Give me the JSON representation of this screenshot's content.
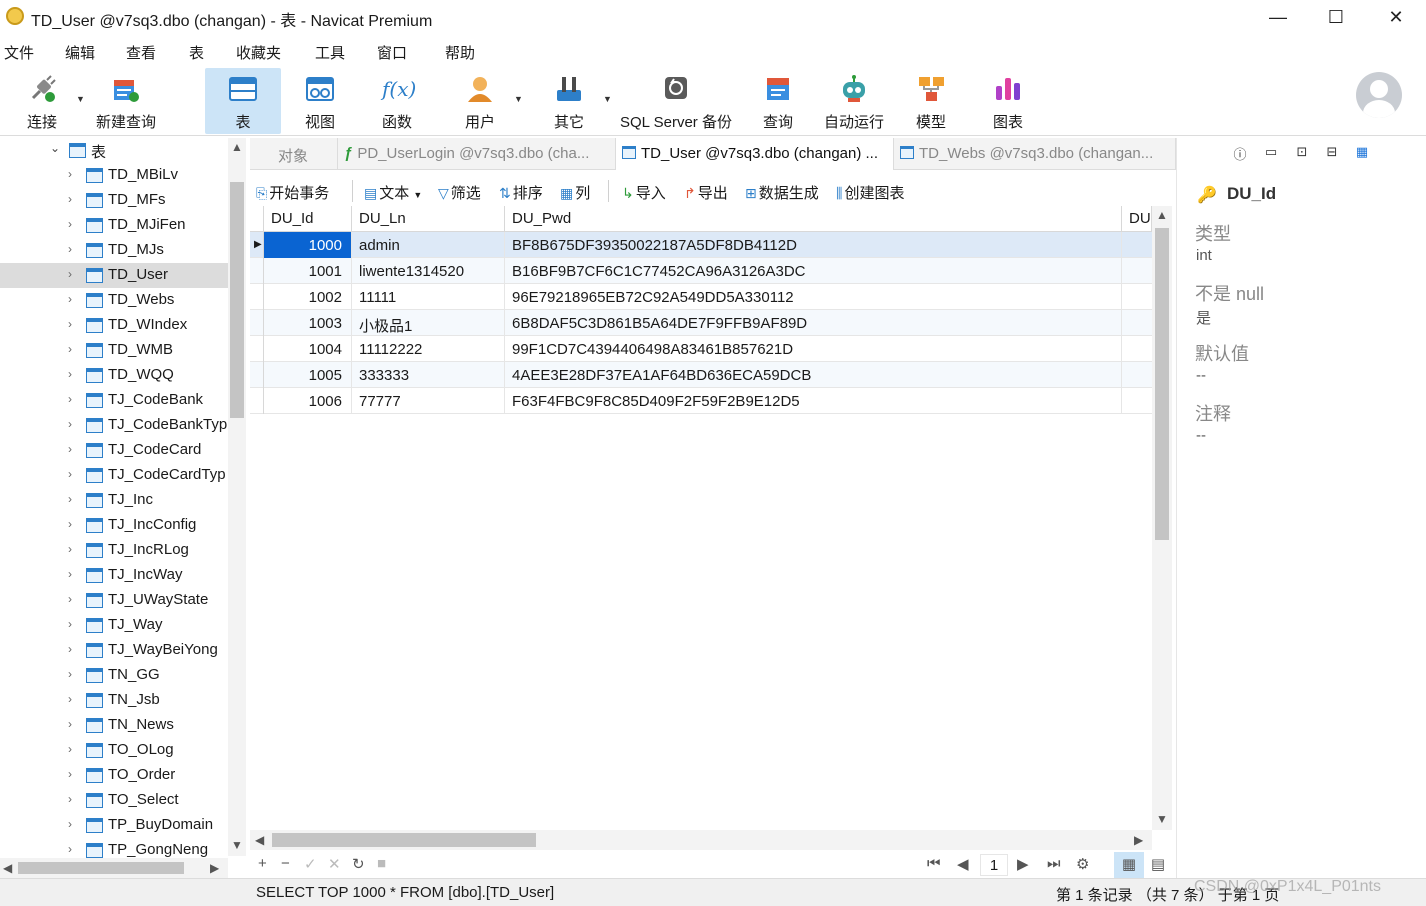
{
  "window": {
    "title": "TD_User @v7sq3.dbo (changan) - 表 - Navicat Premium",
    "minimize": "—",
    "maximize": "☐",
    "close": "✕"
  },
  "menu": [
    "文件",
    "编辑",
    "查看",
    "表",
    "收藏夹",
    "工具",
    "窗口",
    "帮助"
  ],
  "toolbar": [
    {
      "label": "连接",
      "icon": "plug-icon"
    },
    {
      "label": "新建查询",
      "icon": "new-query-icon"
    },
    {
      "label": "表",
      "icon": "table-icon"
    },
    {
      "label": "视图",
      "icon": "view-icon"
    },
    {
      "label": "函数",
      "icon": "function-icon",
      "glyph": "f(x)"
    },
    {
      "label": "用户",
      "icon": "user-icon"
    },
    {
      "label": "其它",
      "icon": "tools-icon"
    },
    {
      "label": "SQL Server 备份",
      "icon": "backup-icon"
    },
    {
      "label": "查询",
      "icon": "query-icon"
    },
    {
      "label": "自动运行",
      "icon": "robot-icon"
    },
    {
      "label": "模型",
      "icon": "model-icon"
    },
    {
      "label": "图表",
      "icon": "chart-icon"
    }
  ],
  "tree": {
    "root": "表",
    "items": [
      "TD_MBiLv",
      "TD_MFs",
      "TD_MJiFen",
      "TD_MJs",
      "TD_User",
      "TD_Webs",
      "TD_WIndex",
      "TD_WMB",
      "TD_WQQ",
      "TJ_CodeBank",
      "TJ_CodeBankTyp",
      "TJ_CodeCard",
      "TJ_CodeCardTyp",
      "TJ_Inc",
      "TJ_IncConfig",
      "TJ_IncRLog",
      "TJ_IncWay",
      "TJ_UWayState",
      "TJ_Way",
      "TJ_WayBeiYong",
      "TN_GG",
      "TN_Jsb",
      "TN_News",
      "TO_OLog",
      "TO_Order",
      "TO_Select",
      "TP_BuyDomain",
      "TP_GongNeng"
    ],
    "selected": "TD_User"
  },
  "tabs": [
    {
      "label": "对象",
      "active": false
    },
    {
      "label": "PD_UserLogin @v7sq3.dbo (cha...",
      "active": false
    },
    {
      "label": "TD_User @v7sq3.dbo (changan) ...",
      "active": true
    },
    {
      "label": "TD_Webs @v7sq3.dbo (changan...",
      "active": false
    }
  ],
  "subtoolbar": {
    "begin_tx": "开始事务",
    "text": "文本",
    "filter": "筛选",
    "sort": "排序",
    "columns": "列",
    "import": "导入",
    "export": "导出",
    "generate": "数据生成",
    "create_chart": "创建图表"
  },
  "grid": {
    "columns": [
      "DU_Id",
      "DU_Ln",
      "DU_Pwd",
      "DU"
    ],
    "rows": [
      [
        "1000",
        "admin",
        "BF8B675DF39350022187A5DF8DB4112D"
      ],
      [
        "1001",
        "liwente1314520",
        "B16BF9B7CF6C1C77452CA96A3126A3DC"
      ],
      [
        "1002",
        "11111",
        "96E79218965EB72C92A549DD5A330112"
      ],
      [
        "1003",
        "小极品1",
        "6B8DAF5C3D861B5A64DE7F9FFB9AF89D"
      ],
      [
        "1004",
        "11112222",
        "99F1CD7C4394406498A83461B857621D"
      ],
      [
        "1005",
        "333333",
        "4AEE3E28DF37EA1AF64BD636ECA59DCB"
      ],
      [
        "1006",
        "77777",
        "F63F4FBC9F8C85D409F2F59F2B9E12D5"
      ]
    ]
  },
  "nav": {
    "page": "1"
  },
  "status": {
    "sql": "SELECT TOP 1000 * FROM [dbo].[TD_User]",
    "records": "第 1 条记录 （共 7 条） 于第 1 页"
  },
  "watermark": "CSDN @0xP1x4L_P01nts",
  "info_panel": {
    "field": "DU_Id",
    "props": [
      {
        "label": "类型",
        "value": "int"
      },
      {
        "label": "不是 null",
        "value": "是"
      },
      {
        "label": "默认值",
        "value": "--"
      },
      {
        "label": "注释",
        "value": "--"
      }
    ]
  },
  "colors": {
    "accent": "#0a64d2",
    "selection": "#cce4f7",
    "table_icon": "#2d7fc9"
  }
}
